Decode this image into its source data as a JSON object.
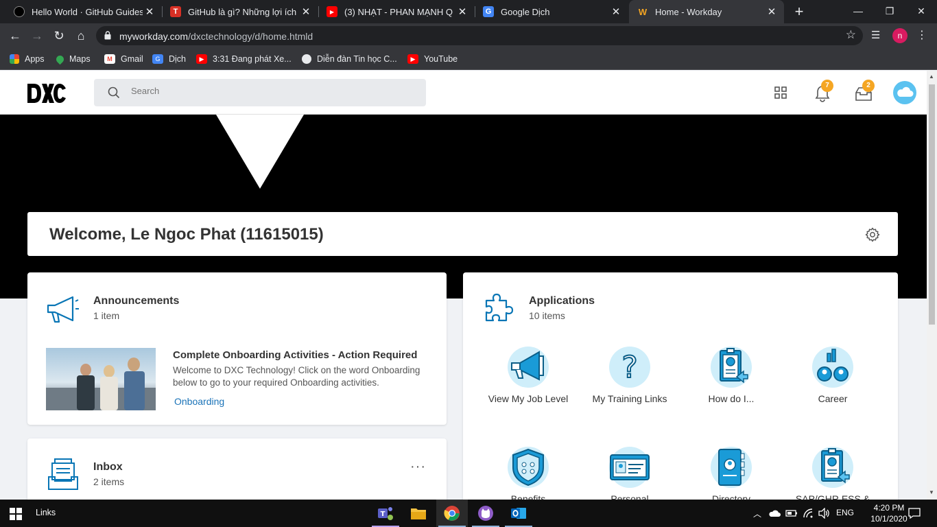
{
  "browser": {
    "tabs": [
      {
        "title": "Hello World · GitHub Guides",
        "icon": "github-icon"
      },
      {
        "title": "GitHub là gì? Những lợi ích Git",
        "icon": "t-icon"
      },
      {
        "title": "(3) NHẠT - PHAN MẠNH Q",
        "icon": "youtube-icon"
      },
      {
        "title": "Google Dịch",
        "icon": "google-translate-icon"
      },
      {
        "title": "Home - Workday",
        "icon": "workday-icon"
      }
    ],
    "url_domain": "myworkday.com",
    "url_path": "/dxctechnology/d/home.htmld",
    "profile_initial": "n",
    "bookmarks": [
      "Apps",
      "Maps",
      "Gmail",
      "Dịch",
      "3:31 Đang phát Xe...",
      "Diễn đàn Tin học C...",
      "YouTube"
    ]
  },
  "header": {
    "search_placeholder": "Search",
    "notifications_count": "7",
    "inbox_count": "2"
  },
  "welcome": {
    "text": "Welcome, Le Ngoc Phat (11615015)"
  },
  "announcements": {
    "title": "Announcements",
    "count": "1 item",
    "item_title": "Complete Onboarding Activities - Action Required",
    "item_body": "Welcome to DXC Technology! Click on the word Onboarding below to go to your required Onboarding activities.",
    "item_link": "Onboarding"
  },
  "inbox": {
    "title": "Inbox",
    "count": "2 items",
    "more": "···"
  },
  "applications": {
    "title": "Applications",
    "count": "10 items",
    "items": [
      {
        "label": "View My Job Level",
        "icon": "megaphone-icon"
      },
      {
        "label": "My Training Links",
        "icon": "question-icon"
      },
      {
        "label": "How do I...",
        "icon": "clipboard-chart-icon"
      },
      {
        "label": "Career",
        "icon": "career-people-icon"
      },
      {
        "label": "Benefits",
        "icon": "benefits-shield-icon"
      },
      {
        "label": "Personal",
        "icon": "personal-id-card-icon"
      },
      {
        "label": "Directory",
        "icon": "directory-book-icon"
      },
      {
        "label": "SAP/GHR ESS & MSS",
        "icon": "clipboard-share-icon"
      }
    ]
  },
  "taskbar": {
    "links_label": "Links",
    "language": "ENG",
    "time": "4:20 PM",
    "date": "10/1/2020"
  },
  "colors": {
    "accent_blue": "#0875b5",
    "app_icon_bg": "#cfeefa",
    "badge": "#f5a623",
    "link": "#1a73b8"
  }
}
